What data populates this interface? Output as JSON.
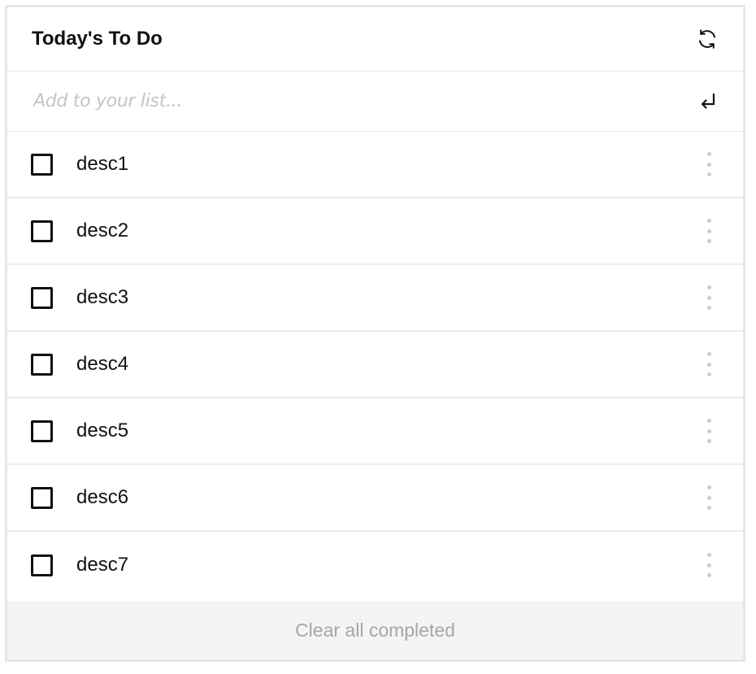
{
  "header": {
    "title": "Today's To Do",
    "refresh_icon": "refresh-icon"
  },
  "add_task": {
    "value": "",
    "placeholder": "Add to your list...",
    "submit_icon": "enter-return-icon"
  },
  "tasks": [
    {
      "label": "desc1",
      "completed": false
    },
    {
      "label": "desc2",
      "completed": false
    },
    {
      "label": "desc3",
      "completed": false
    },
    {
      "label": "desc4",
      "completed": false
    },
    {
      "label": "desc5",
      "completed": false
    },
    {
      "label": "desc6",
      "completed": false
    },
    {
      "label": "desc7",
      "completed": false
    }
  ],
  "footer": {
    "clear_label": "Clear all completed"
  },
  "colors": {
    "text": "#111111",
    "placeholder": "#c4c4c4",
    "kebab_dots": "#bcd0dc",
    "footer_bg": "#f4f4f4",
    "footer_text": "#a6a6a6",
    "border": "#e6e6e6"
  }
}
